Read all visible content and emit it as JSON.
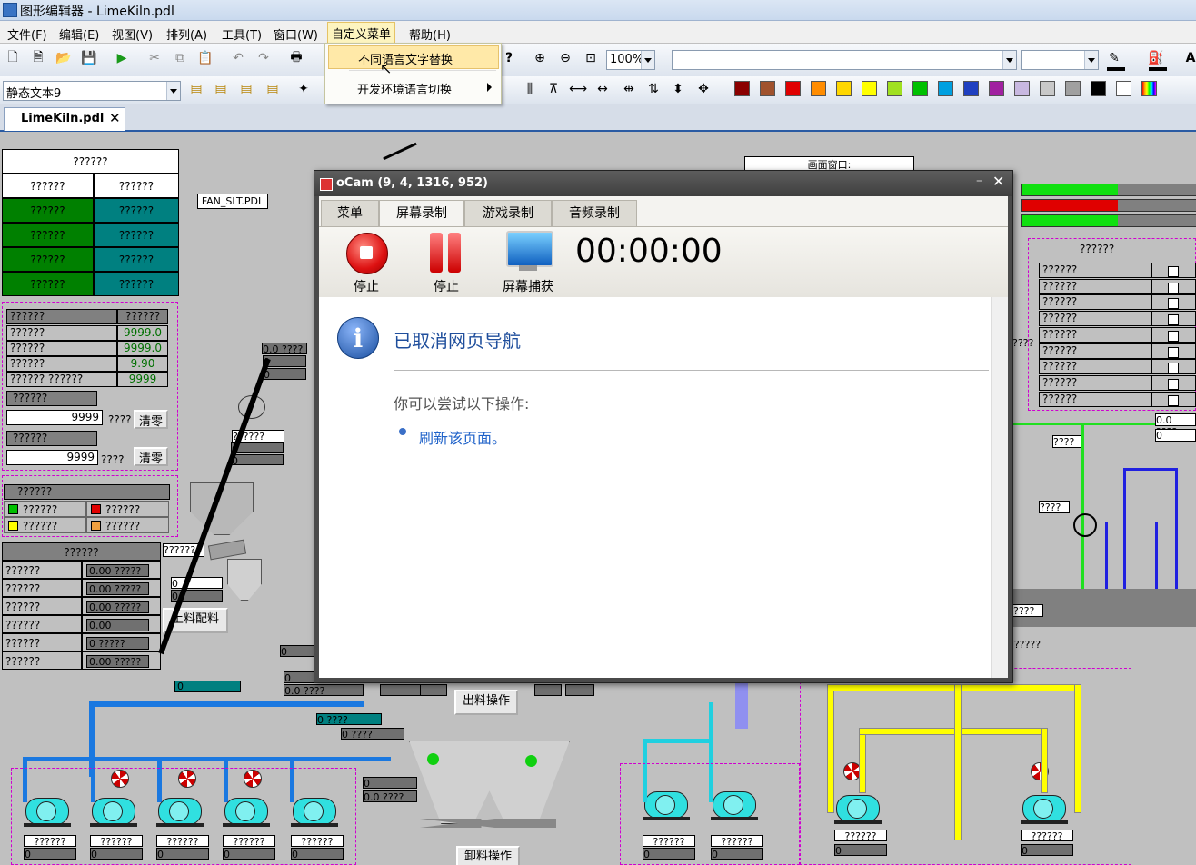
{
  "window": {
    "title": "图形编辑器 - LimeKiln.pdl"
  },
  "menubar": {
    "items": [
      "文件(F)",
      "编辑(E)",
      "视图(V)",
      "排列(A)",
      "工具(T)",
      "窗口(W)",
      "自定义菜单",
      "帮助(H)"
    ]
  },
  "dropdown": {
    "items": [
      "不同语言文字替换",
      "开发环境语言切换"
    ]
  },
  "toolbar": {
    "zoom": "100%",
    "object_type": "静态文本9"
  },
  "colors": [
    "#8b0000",
    "#a0522d",
    "#e00000",
    "#ff8c00",
    "#ffd700",
    "#ffff00",
    "#a0e020",
    "#00c000",
    "#00a0e0",
    "#2040c0",
    "#a020a0",
    "#c8b8e0",
    "#c8c8c8",
    "#a0a0a0",
    "#000000",
    "#ffffff"
  ],
  "tab": {
    "label": "LimeKiln.pdl"
  },
  "canvas": {
    "header_cell": "??????",
    "table1": {
      "title": "??????",
      "cols": [
        "??????",
        "??????"
      ],
      "rows": 4,
      "cell": "??????"
    },
    "table2": {
      "header": [
        "??????",
        "??????"
      ],
      "rows": [
        [
          "??????",
          "9999.0"
        ],
        [
          "??????",
          "9999.0"
        ],
        [
          "??????",
          "9.90"
        ],
        [
          "?????? ??????",
          "9999"
        ]
      ]
    },
    "input1": {
      "label": "??????",
      "value": "9999",
      "unit": "????",
      "button": "清零"
    },
    "input2": {
      "label": "??????",
      "value": "9999",
      "unit": "????",
      "button": "清零"
    },
    "legend": {
      "title": "??????",
      "items": [
        "??????",
        "??????",
        "??????",
        "??????"
      ],
      "colors": [
        "#00c000",
        "#e00000",
        "#ffff00",
        "#f0a040"
      ]
    },
    "table3": {
      "title": "??????",
      "rows": [
        [
          "??????",
          "0.00 ?????"
        ],
        [
          "??????",
          "0.00 ?????"
        ],
        [
          "??????",
          "0.00 ?????"
        ],
        [
          "??????",
          "0.00"
        ],
        [
          "??????",
          "0 ?????"
        ],
        [
          "??????",
          "0.00 ?????"
        ]
      ]
    },
    "fan_label": "FAN_SLT.PDL",
    "window_label": "画面窗口:",
    "btn_feed": "上料配料",
    "btn_out": "出料操作",
    "btn_unload": "卸料操作",
    "checklist": {
      "title": "??????",
      "items": [
        "??????",
        "??????",
        "??????",
        "??????",
        "??????",
        "??????",
        "??????",
        "??????",
        "??????"
      ]
    },
    "small_val": "0.0 ????",
    "q": "????",
    "q6": "??????",
    "zero": "0",
    "zero_q": "0 ????",
    "zz": "0.0 ????"
  },
  "ocam": {
    "title": "oCam (9, 4, 1316, 952)",
    "tabs": [
      "菜单",
      "屏幕录制",
      "游戏录制",
      "音频录制"
    ],
    "buttons": [
      "停止",
      "停止",
      "屏幕捕获"
    ],
    "timer": "00:00:00",
    "page_title": "已取消网页导航",
    "page_hint": "你可以尝试以下操作:",
    "page_link": "刷新该页面。"
  }
}
